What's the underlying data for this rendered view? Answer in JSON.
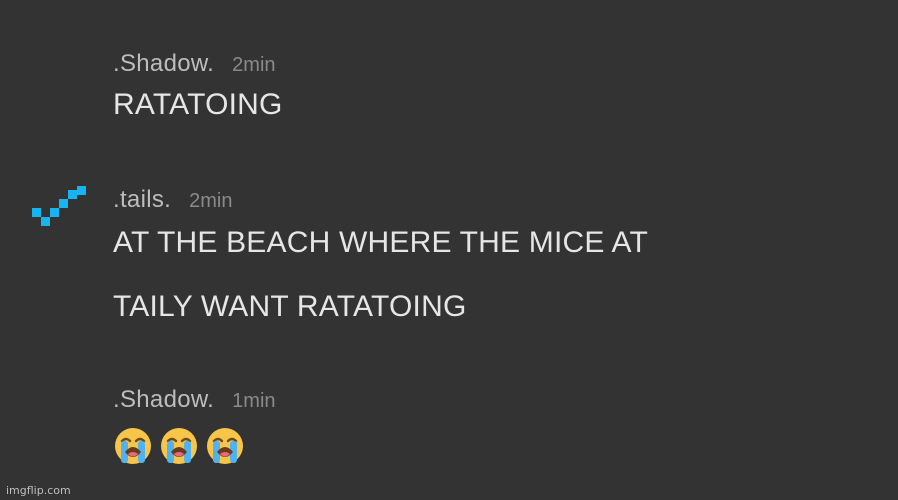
{
  "messages": [
    {
      "username": ".Shadow.",
      "time": "2min",
      "lines": [
        "RATATOING"
      ]
    },
    {
      "username": ".tails.",
      "time": "2min",
      "lines": [
        "AT THE BEACH WHERE THE MICE AT",
        "TAILY WANT RATATOING"
      ],
      "avatar_icon": "pixel-check-icon",
      "avatar_color": "#16b4f0"
    },
    {
      "username": ".Shadow.",
      "time": "1min",
      "emojis": [
        "loudly-crying-face-icon",
        "loudly-crying-face-icon",
        "loudly-crying-face-icon"
      ]
    }
  ],
  "colors": {
    "background": "#333333",
    "username": "#bdbdbd",
    "timestamp": "#8a8a8a",
    "message_text": "#e6e6e6"
  },
  "watermark": "imgflip.com"
}
